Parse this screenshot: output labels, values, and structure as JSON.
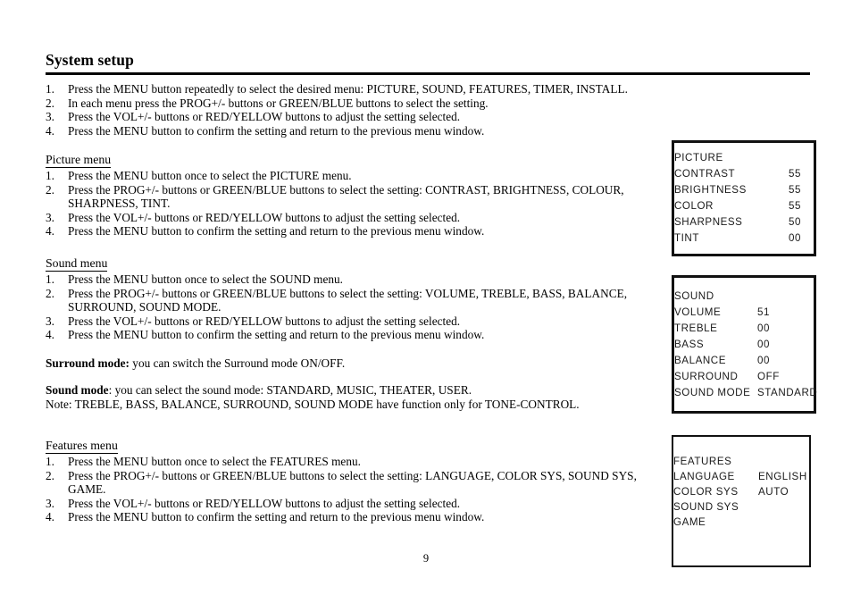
{
  "document": {
    "title": "System setup",
    "page_number": "9"
  },
  "intro": {
    "steps": [
      {
        "num": "1.",
        "text": "Press the MENU button repeatedly to select the desired menu: PICTURE, SOUND, FEATURES, TIMER, INSTALL."
      },
      {
        "num": "2.",
        "text": "In each menu press the PROG+/- buttons or GREEN/BLUE buttons to select the setting."
      },
      {
        "num": "3.",
        "text": "Press the VOL+/- buttons or RED/YELLOW buttons to adjust the setting selected."
      },
      {
        "num": "4.",
        "text": "Press the MENU button to confirm the setting and return to the previous menu window."
      }
    ]
  },
  "picture_section": {
    "heading": "Picture menu",
    "steps": [
      {
        "num": "1.",
        "text": "Press the MENU button once to select the PICTURE menu."
      },
      {
        "num": "2.",
        "text": "Press the PROG+/- buttons or GREEN/BLUE buttons to select the setting: CONTRAST, BRIGHTNESS, COLOUR,",
        "cont": "SHARPNESS, TINT."
      },
      {
        "num": "3.",
        "text": "Press the VOL+/- buttons or RED/YELLOW buttons to adjust the setting selected."
      },
      {
        "num": "4.",
        "text": "Press the MENU button to confirm the setting and return to the previous menu window."
      }
    ]
  },
  "sound_section": {
    "heading": "Sound menu",
    "steps": [
      {
        "num": "1.",
        "text": "Press the MENU button once to select the SOUND menu."
      },
      {
        "num": "2.",
        "text": "Press the PROG+/- buttons or GREEN/BLUE buttons to select the setting: VOLUME, TREBLE, BASS, BALANCE,",
        "cont": "SURROUND, SOUND MODE."
      },
      {
        "num": "3.",
        "text": "Press the VOL+/- buttons or RED/YELLOW buttons to adjust the setting selected."
      },
      {
        "num": "4.",
        "text": "Press the MENU button to confirm the setting and return to the previous menu window."
      }
    ],
    "surround_note_label": "Surround mode:",
    "surround_note_text": " you can switch the Surround mode ON/OFF.",
    "sound_mode_label": "Sound mode",
    "sound_mode_text": ": you can select the sound mode: STANDARD, MUSIC, THEATER, USER.",
    "note_text": "Note: TREBLE, BASS, BALANCE, SURROUND, SOUND MODE have function only for TONE-CONTROL."
  },
  "features_section": {
    "heading": "Features menu",
    "steps": [
      {
        "num": "1.",
        "text": "Press the MENU button once to select the FEATURES menu."
      },
      {
        "num": "2.",
        "text": "Press the PROG+/- buttons or GREEN/BLUE buttons to select the setting: LANGUAGE, COLOR SYS, SOUND SYS,",
        "cont": "GAME."
      },
      {
        "num": "3.",
        "text": "Press the VOL+/- buttons or RED/YELLOW buttons to adjust the setting selected."
      },
      {
        "num": "4.",
        "text": "Press the MENU button to confirm the setting and return to the previous menu window."
      }
    ]
  },
  "osd_picture": {
    "title": "PICTURE",
    "rows": [
      {
        "label": "CONTRAST",
        "value": "55"
      },
      {
        "label": "BRIGHTNESS",
        "value": "55"
      },
      {
        "label": "COLOR",
        "value": "55"
      },
      {
        "label": "SHARPNESS",
        "value": "50"
      },
      {
        "label": "TINT",
        "value": "00"
      }
    ]
  },
  "osd_sound": {
    "title": "SOUND",
    "rows": [
      {
        "label": "VOLUME",
        "value": "51"
      },
      {
        "label": "TREBLE",
        "value": "00"
      },
      {
        "label": "BASS",
        "value": "00"
      },
      {
        "label": "BALANCE",
        "value": "00"
      },
      {
        "label": "SURROUND",
        "value": "OFF"
      },
      {
        "label": "SOUND MODE",
        "value": "STANDARD"
      }
    ]
  },
  "osd_features": {
    "title": "FEATURES",
    "rows": [
      {
        "label": "LANGUAGE",
        "value": "ENGLISH"
      },
      {
        "label": "COLOR SYS",
        "value": "AUTO"
      },
      {
        "label": "SOUND SYS",
        "value": ""
      },
      {
        "label": "GAME",
        "value": ""
      }
    ]
  },
  "colors": {
    "text": "#000000",
    "osd_border": "#111111",
    "background": "#ffffff"
  }
}
